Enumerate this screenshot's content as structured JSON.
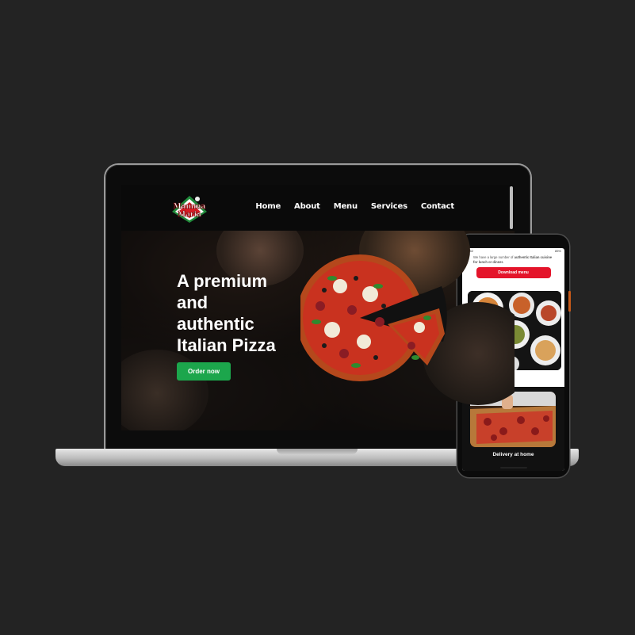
{
  "laptop": {
    "logo": {
      "line1": "Mamma",
      "line2": "Maria"
    },
    "nav": {
      "items": [
        {
          "label": "Home"
        },
        {
          "label": "About"
        },
        {
          "label": "Menu"
        },
        {
          "label": "Services"
        },
        {
          "label": "Contact"
        }
      ]
    },
    "hero": {
      "title_lines": [
        "A premium",
        "and",
        "authentic",
        "Italian Pizza"
      ],
      "cta_label": "Order now"
    }
  },
  "phone": {
    "status": {
      "time": "10:52",
      "battery": "85%"
    },
    "intro_prefix": "We have a large number of ",
    "intro_bold": "authentic Italian cuisine for lunch or dinner.",
    "download_label": "Download menu",
    "delivery_label": "Delivery at home"
  },
  "colors": {
    "background": "#232323",
    "cta_green": "#1ca64c",
    "download_red": "#e4142a",
    "logo_red": "#d81b23",
    "logo_green": "#1f8a3a"
  },
  "icons": [
    "pizza-image",
    "food-image",
    "pizza-delivery-image",
    "logo-icon"
  ]
}
